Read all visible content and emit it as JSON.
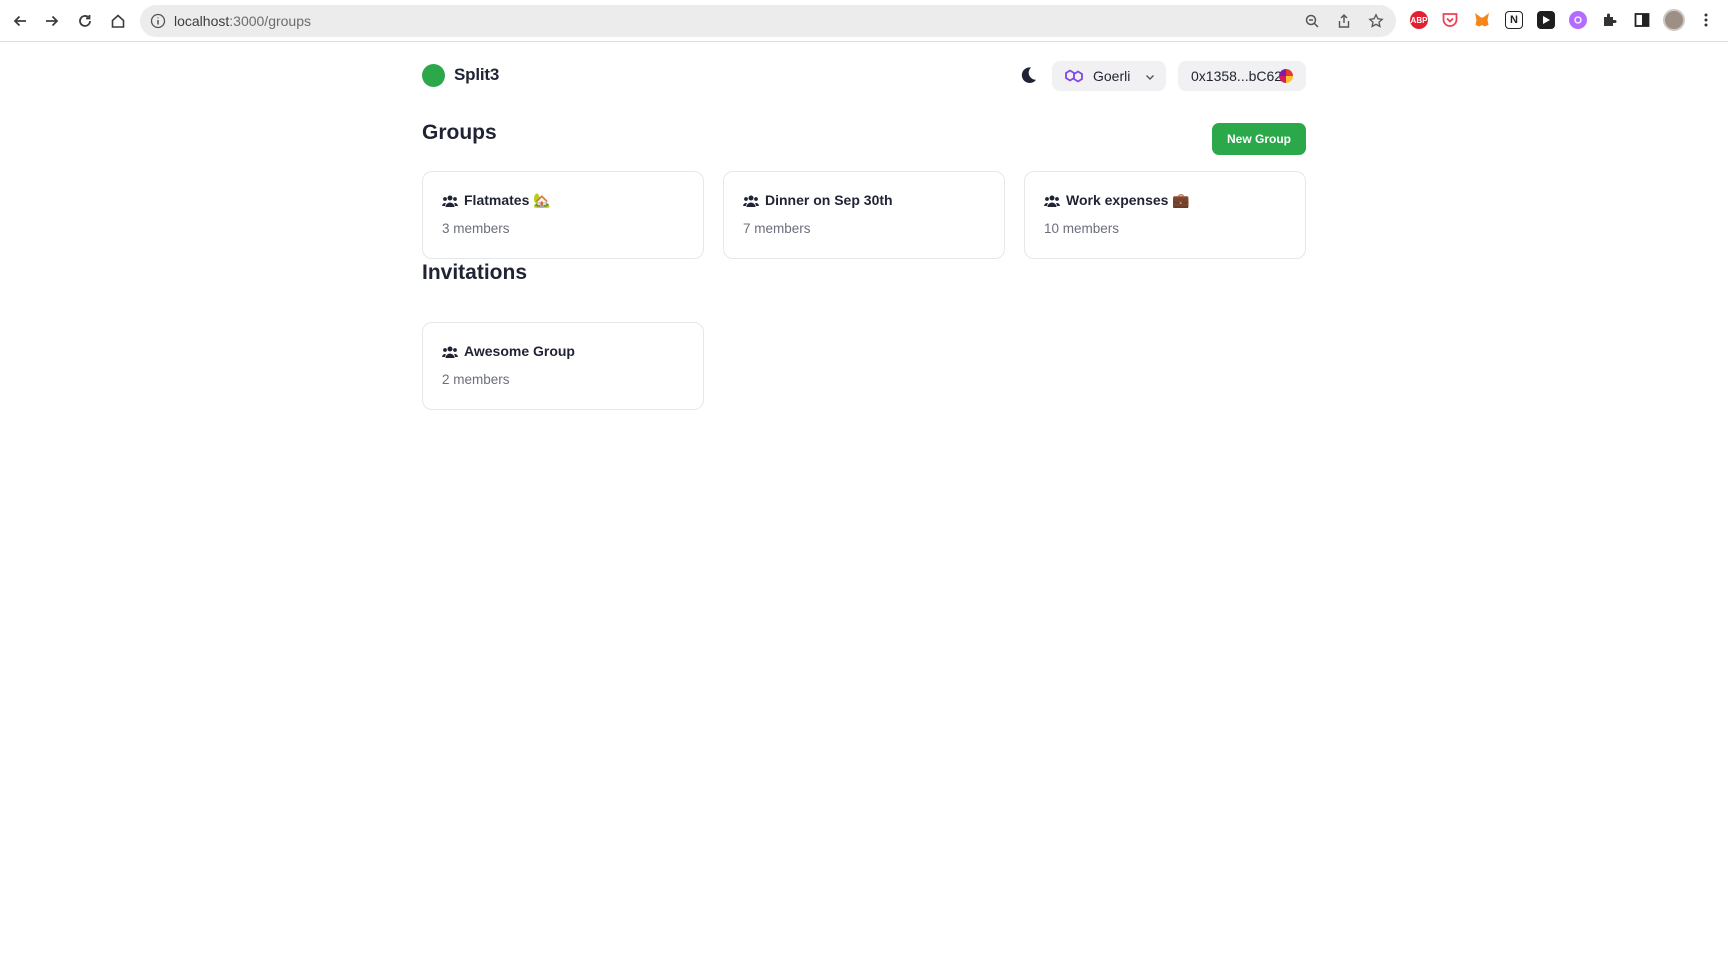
{
  "browser": {
    "url_host": "localhost",
    "url_path": ":3000/groups",
    "extensions": [
      {
        "name": "adblock-icon",
        "label": "ABP",
        "color": "#e2202f"
      },
      {
        "name": "pocket-icon",
        "label": "",
        "color": "#ef4056"
      },
      {
        "name": "metamask-icon",
        "label": "",
        "color": "#f6851b"
      },
      {
        "name": "notion-icon",
        "label": "N",
        "color": "#222222"
      },
      {
        "name": "extension-play-icon",
        "label": "",
        "color": "#1e1e1e"
      },
      {
        "name": "extension-purple-icon",
        "label": "",
        "color": "#b36cff"
      }
    ]
  },
  "header": {
    "app_name": "Split3",
    "network": "Goerli",
    "account": "0x1358...bC62",
    "accent_color": "#2aa84a"
  },
  "groups": {
    "title": "Groups",
    "new_group_label": "New Group",
    "items": [
      {
        "name": "Flatmates 🏡",
        "members": "3 members"
      },
      {
        "name": "Dinner on Sep 30th",
        "members": "7 members"
      },
      {
        "name": "Work expenses 💼",
        "members": "10 members"
      }
    ]
  },
  "invitations": {
    "title": "Invitations",
    "items": [
      {
        "name": "Awesome Group",
        "members": "2 members"
      }
    ]
  }
}
